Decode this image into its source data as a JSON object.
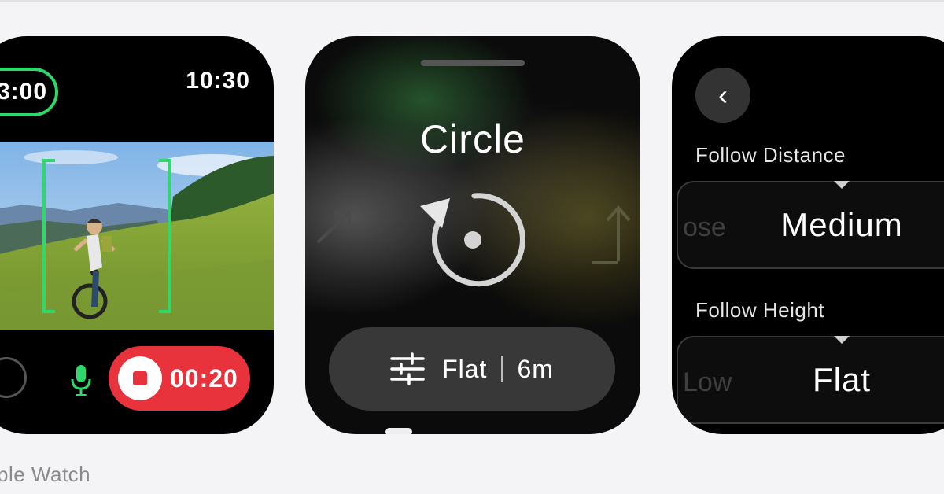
{
  "watch1": {
    "timer_text": "3:00",
    "clock": "10:30",
    "record_time": "00:20",
    "accent_color": "#2fd86a",
    "record_color": "#e8333d",
    "icons": [
      "mic-icon",
      "stop-icon",
      "tracking-bracket-icon"
    ]
  },
  "watch2": {
    "mode_title": "Circle",
    "pill": {
      "terrain": "Flat",
      "height": "6m"
    },
    "icons": [
      "circle-orbit-icon",
      "diagonal-arrow-icon",
      "rise-arrow-icon",
      "sliders-icon"
    ]
  },
  "watch3": {
    "back_icon": "‹",
    "distance": {
      "label": "Follow Distance",
      "prev": "ose",
      "value": "Medium"
    },
    "height": {
      "label": "Follow Height",
      "prev": "Low",
      "value": "Flat"
    }
  },
  "caption": "ple Watch"
}
